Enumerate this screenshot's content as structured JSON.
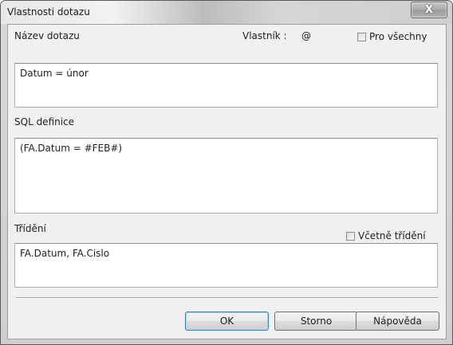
{
  "window": {
    "title": "Vlastnosti dotazu",
    "close_glyph": "X"
  },
  "query_name": {
    "label": "Název dotazu",
    "value": "Datum = únor"
  },
  "owner": {
    "label": "Vlastník :",
    "value": "@"
  },
  "for_all": {
    "label": "Pro všechny",
    "checked": false
  },
  "sql": {
    "label": "SQL definice",
    "value": "(FA.Datum = #FEB#)"
  },
  "sorting": {
    "label": "Třídění",
    "value": "FA.Datum, FA.Cislo"
  },
  "include_sorting": {
    "label": "Včetně třídění",
    "checked": false
  },
  "buttons": {
    "ok": "OK",
    "cancel": "Storno",
    "help": "Nápověda"
  },
  "colors": {
    "accent_default_button": "#3c7fb1",
    "client_bg": "#f0f0f0"
  }
}
